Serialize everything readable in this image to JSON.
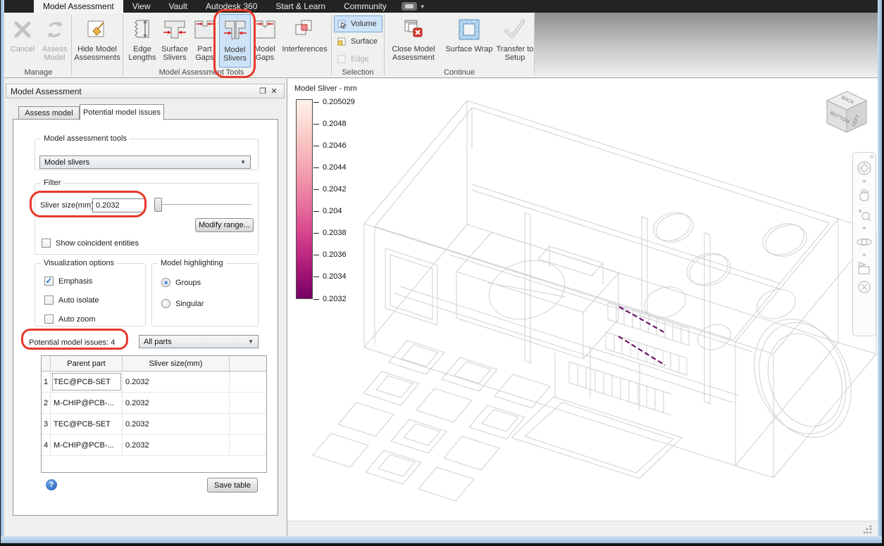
{
  "menubar": {
    "tabs": [
      "Model Assessment",
      "View",
      "Vault",
      "Autodesk 360",
      "Start & Learn",
      "Community"
    ],
    "active_tab": "Model Assessment"
  },
  "ribbon": {
    "cancel": "Cancel",
    "assess_model": "Assess Model",
    "hide_model": "Hide Model Assessments",
    "edge_lengths": "Edge Lengths",
    "surface_slivers": "Surface Slivers",
    "part_gaps": "Part Gaps",
    "model_slivers": "Model Slivers",
    "model_gaps": "Model Gaps",
    "interferences": "Interferences",
    "volume": "Volume",
    "surface": "Surface",
    "edge": "Edge",
    "close_model": "Close Model Assessment",
    "surface_wrap": "Surface Wrap",
    "transfer_to_setup": "Transfer to Setup",
    "groups": {
      "manage": "Manage",
      "tools": "Model Assessment Tools",
      "selection": "Selection",
      "continue": "Continue"
    }
  },
  "panel": {
    "title": "Model Assessment",
    "tabs": {
      "assess": "Assess model",
      "issues": "Potential model issues"
    },
    "tools_group": {
      "label": "Model assessment tools",
      "combo_value": "Model slivers"
    },
    "filter_group": {
      "label": "Filter",
      "sliver_size_label": "Sliver size(mm)",
      "sliver_size_value": "0.2032",
      "modify_range": "Modify range...",
      "show_coincident": "Show coincident entities",
      "show_coincident_checked": false
    },
    "visualization_group": {
      "label": "Visualization options",
      "options": [
        {
          "label": "Emphasis",
          "checked": true
        },
        {
          "label": "Auto isolate",
          "checked": false
        },
        {
          "label": "Auto zoom",
          "checked": false
        }
      ]
    },
    "highlighting_group": {
      "label": "Model highlighting",
      "options": [
        {
          "label": "Groups",
          "selected": true
        },
        {
          "label": "Singular",
          "selected": false
        }
      ]
    },
    "issues_label": "Potential model issues:",
    "issues_count": "4",
    "parts_combo_value": "All parts",
    "table": {
      "headers": [
        "Parent part",
        "Sliver size(mm)"
      ],
      "rows": [
        {
          "num": "1",
          "parent": "TEC@PCB-SET",
          "sliver": "0.2032"
        },
        {
          "num": "2",
          "parent": "M-CHIP@PCB-...",
          "sliver": "0.2032"
        },
        {
          "num": "3",
          "parent": "TEC@PCB-SET",
          "sliver": "0.2032"
        },
        {
          "num": "4",
          "parent": "M-CHIP@PCB-...",
          "sliver": "0.2032"
        }
      ]
    },
    "save_table": "Save table"
  },
  "viewport": {
    "legend": {
      "title": "Model Sliver - mm",
      "ticks": [
        "0.205029",
        "0.2048",
        "0.2046",
        "0.2044",
        "0.2042",
        "0.204",
        "0.2038",
        "0.2036",
        "0.2034",
        "0.2032"
      ],
      "top_color": "#fdf2ea",
      "bottom_color": "#730263"
    },
    "viewcube": {
      "top": "BACK",
      "left": "BOTTOM",
      "right": "LEFT"
    },
    "sliver_highlight_color": "#65005c",
    "wireframe_color": "#cdd0d3"
  },
  "colors": {
    "annotation_red": "#e6392b",
    "selection_blue": "#cfe3f7",
    "ribbon_bg": "#f0f0ee",
    "menubar_bg": "#232323"
  }
}
